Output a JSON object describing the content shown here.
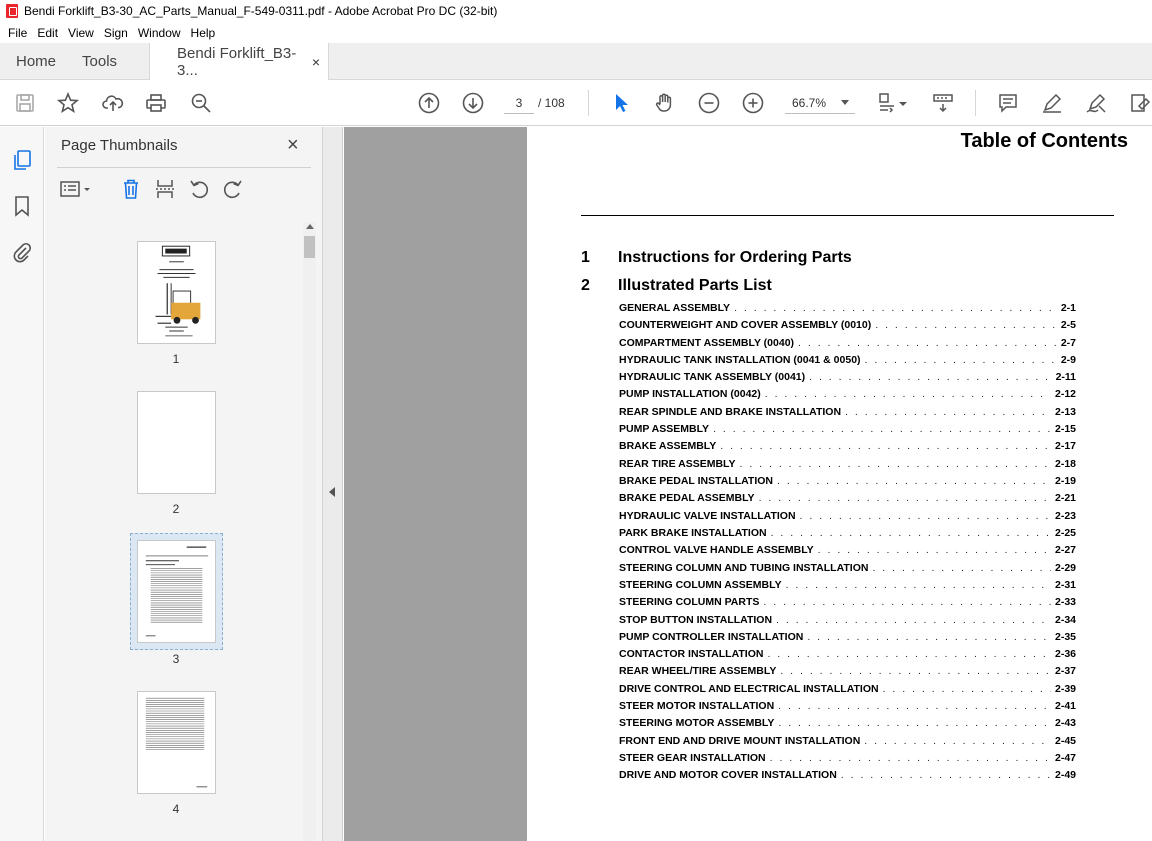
{
  "window": {
    "title": "Bendi Forklift_B3-30_AC_Parts_Manual_F-549-0311.pdf - Adobe Acrobat Pro DC (32-bit)"
  },
  "menu": [
    "File",
    "Edit",
    "View",
    "Sign",
    "Window",
    "Help"
  ],
  "tabs": {
    "home": "Home",
    "tools": "Tools",
    "document": "Bendi Forklift_B3-3...",
    "close": "×"
  },
  "toolbar": {
    "page_current": "3",
    "page_total": "/ 108",
    "zoom": "66.7%"
  },
  "thumbnails": {
    "title": "Page Thumbnails",
    "close": "×",
    "pages": [
      "1",
      "2",
      "3",
      "4"
    ]
  },
  "document": {
    "title": "Table of Contents",
    "sections": [
      {
        "num": "1",
        "label": "Instructions for Ordering Parts"
      },
      {
        "num": "2",
        "label": "Illustrated Parts List"
      }
    ],
    "entries": [
      {
        "label": "GENERAL ASSEMBLY",
        "page": "2-1"
      },
      {
        "label": "COUNTERWEIGHT AND COVER ASSEMBLY (0010)",
        "page": "2-5"
      },
      {
        "label": "COMPARTMENT ASSEMBLY (0040)",
        "page": "2-7"
      },
      {
        "label": "HYDRAULIC TANK INSTALLATION (0041 & 0050)",
        "page": "2-9"
      },
      {
        "label": "HYDRAULIC TANK ASSEMBLY (0041)",
        "page": "2-11"
      },
      {
        "label": "PUMP INSTALLATION (0042)",
        "page": "2-12"
      },
      {
        "label": "REAR SPINDLE AND BRAKE INSTALLATION",
        "page": "2-13"
      },
      {
        "label": "PUMP ASSEMBLY",
        "page": "2-15"
      },
      {
        "label": "BRAKE ASSEMBLY",
        "page": "2-17"
      },
      {
        "label": "REAR TIRE ASSEMBLY",
        "page": "2-18"
      },
      {
        "label": "BRAKE PEDAL INSTALLATION",
        "page": "2-19"
      },
      {
        "label": "BRAKE PEDAL ASSEMBLY",
        "page": "2-21"
      },
      {
        "label": "HYDRAULIC VALVE INSTALLATION",
        "page": "2-23"
      },
      {
        "label": "PARK BRAKE INSTALLATION",
        "page": "2-25"
      },
      {
        "label": "CONTROL VALVE HANDLE ASSEMBLY",
        "page": "2-27"
      },
      {
        "label": "STEERING COLUMN AND TUBING INSTALLATION",
        "page": "2-29"
      },
      {
        "label": "STEERING COLUMN ASSEMBLY",
        "page": "2-31"
      },
      {
        "label": "STEERING COLUMN PARTS",
        "page": "2-33"
      },
      {
        "label": "STOP BUTTON INSTALLATION",
        "page": "2-34"
      },
      {
        "label": "PUMP CONTROLLER INSTALLATION",
        "page": "2-35"
      },
      {
        "label": "CONTACTOR INSTALLATION",
        "page": "2-36"
      },
      {
        "label": "REAR WHEEL/TIRE ASSEMBLY",
        "page": "2-37"
      },
      {
        "label": "DRIVE CONTROL AND ELECTRICAL INSTALLATION",
        "page": "2-39"
      },
      {
        "label": "STEER MOTOR INSTALLATION",
        "page": "2-41"
      },
      {
        "label": "STEERING MOTOR ASSEMBLY",
        "page": "2-43"
      },
      {
        "label": "FRONT END AND DRIVE MOUNT INSTALLATION",
        "page": "2-45"
      },
      {
        "label": "STEER GEAR INSTALLATION",
        "page": "2-47"
      },
      {
        "label": "DRIVE AND MOTOR COVER INSTALLATION",
        "page": "2-49"
      }
    ]
  }
}
